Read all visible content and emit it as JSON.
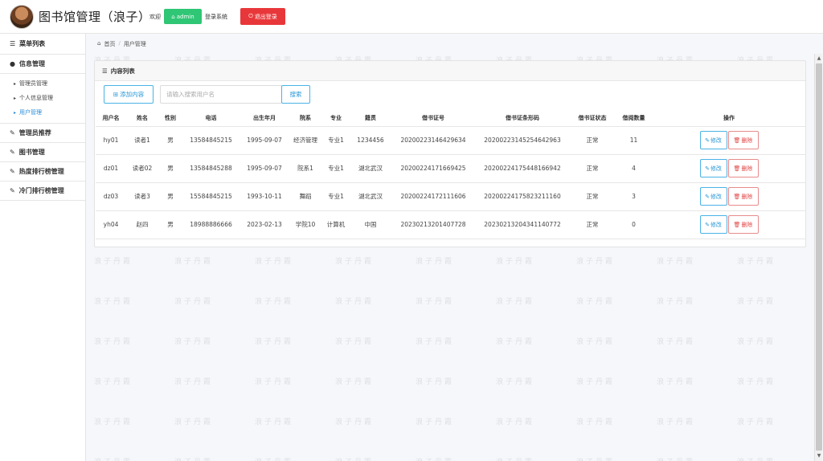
{
  "header": {
    "title": "图书馆管理（浪子）",
    "welcome": "欢迎",
    "user": "admin",
    "system_text": "登录系统",
    "logout": "退出登录"
  },
  "sidebar": {
    "title": "菜单列表",
    "groups": [
      {
        "label": "信息管理",
        "icon": "user-icon"
      },
      {
        "label": "管理员推荐",
        "icon": "edit-icon"
      },
      {
        "label": "图书管理",
        "icon": "edit-icon"
      },
      {
        "label": "热度排行榜管理",
        "icon": "edit-icon"
      },
      {
        "label": "冷门排行榜管理",
        "icon": "edit-icon"
      }
    ],
    "subitems": [
      "管理员管理",
      "个人信息管理",
      "用户管理"
    ],
    "active_subitem": "用户管理"
  },
  "breadcrumb": {
    "home": "首页",
    "current": "用户管理"
  },
  "panel": {
    "title": "内容列表",
    "add_label": "添加内容",
    "search_placeholder": "请输入搜索用户名",
    "search_label": "搜索"
  },
  "table": {
    "columns": [
      "用户名",
      "姓名",
      "性别",
      "电话",
      "出生年月",
      "院系",
      "专业",
      "籍贯",
      "借书证号",
      "借书证条形码",
      "借书证状态",
      "借阅数量",
      "操作"
    ],
    "rows": [
      [
        "hy01",
        "读者1",
        "男",
        "13584845215",
        "1995-09-07",
        "经济管理",
        "专业1",
        "1234456",
        "20200223146429634",
        "20200223145254642963",
        "正常",
        "11"
      ],
      [
        "dz01",
        "读者02",
        "男",
        "13584845288",
        "1995-09-07",
        "院系1",
        "专业1",
        "湖北武汉",
        "20200224171669425",
        "20200224175448166942",
        "正常",
        "4"
      ],
      [
        "dz03",
        "读者3",
        "男",
        "15584845215",
        "1993-10-11",
        "舞蹈",
        "专业1",
        "湖北武汉",
        "20200224172111606",
        "20200224175823211160",
        "正常",
        "3"
      ],
      [
        "yh04",
        "赵四",
        "男",
        "18988886666",
        "2023-02-13",
        "学院10",
        "计算机",
        "中国",
        "20230213201407728",
        "20230213204341140772",
        "正常",
        "0"
      ]
    ],
    "edit_label": "修改",
    "delete_label": "删除"
  },
  "watermark": "浪子丹霞",
  "colors": {
    "accent": "#2a98d6",
    "success": "#2fc675",
    "danger": "#e8373a"
  }
}
